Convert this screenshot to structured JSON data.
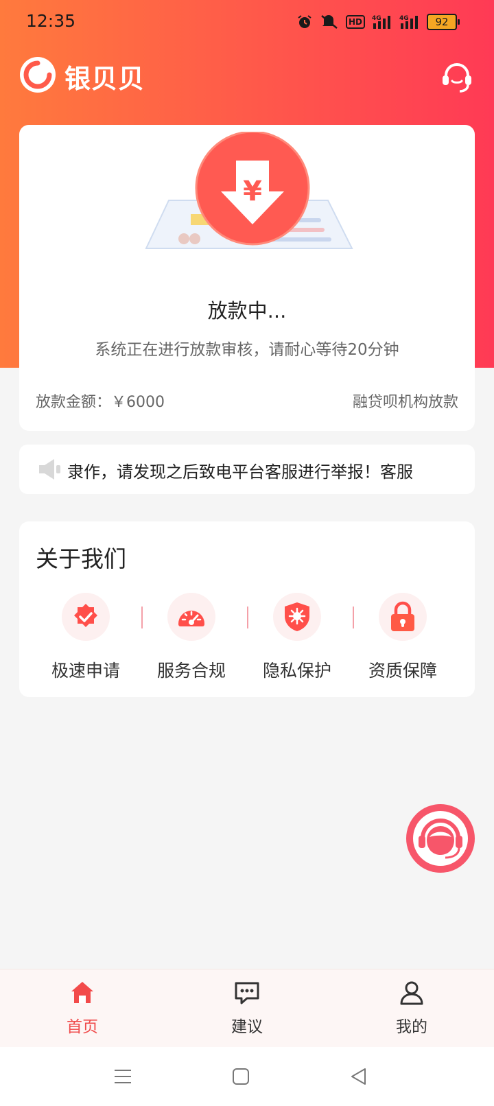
{
  "status_bar": {
    "time": "12:35",
    "icons": [
      "alarm-icon",
      "mute-icon",
      "hd-icon",
      "signal-4g-icon",
      "signal-4g-icon"
    ],
    "hd_label": "HD",
    "network_label": "4G",
    "battery_level": "92"
  },
  "app": {
    "name": "银贝贝",
    "accent_color": "#ff4a4a"
  },
  "status_card": {
    "currency_symbol": "¥",
    "title": "放款中...",
    "description": "系统正在进行放款审核，请耐心等待20分钟",
    "amount_label": "放款金额：",
    "amount_value": "￥6000",
    "agency": "融贷呗机构放款"
  },
  "notice": {
    "text": "隶作，请发现之后致电平台客服进行举报！客服"
  },
  "about": {
    "title": "关于我们",
    "features": [
      {
        "label": "极速申请",
        "icon": "badge-check-icon"
      },
      {
        "label": "服务合规",
        "icon": "speedometer-icon"
      },
      {
        "label": "隐私保护",
        "icon": "shield-icon"
      },
      {
        "label": "资质保障",
        "icon": "lock-icon"
      }
    ]
  },
  "bottom_nav": {
    "items": [
      {
        "label": "首页",
        "icon": "home-icon",
        "active": true
      },
      {
        "label": "建议",
        "icon": "chat-icon",
        "active": false
      },
      {
        "label": "我的",
        "icon": "user-icon",
        "active": false
      }
    ]
  },
  "system_nav": [
    "menu-icon",
    "home-square-icon",
    "back-triangle-icon"
  ]
}
